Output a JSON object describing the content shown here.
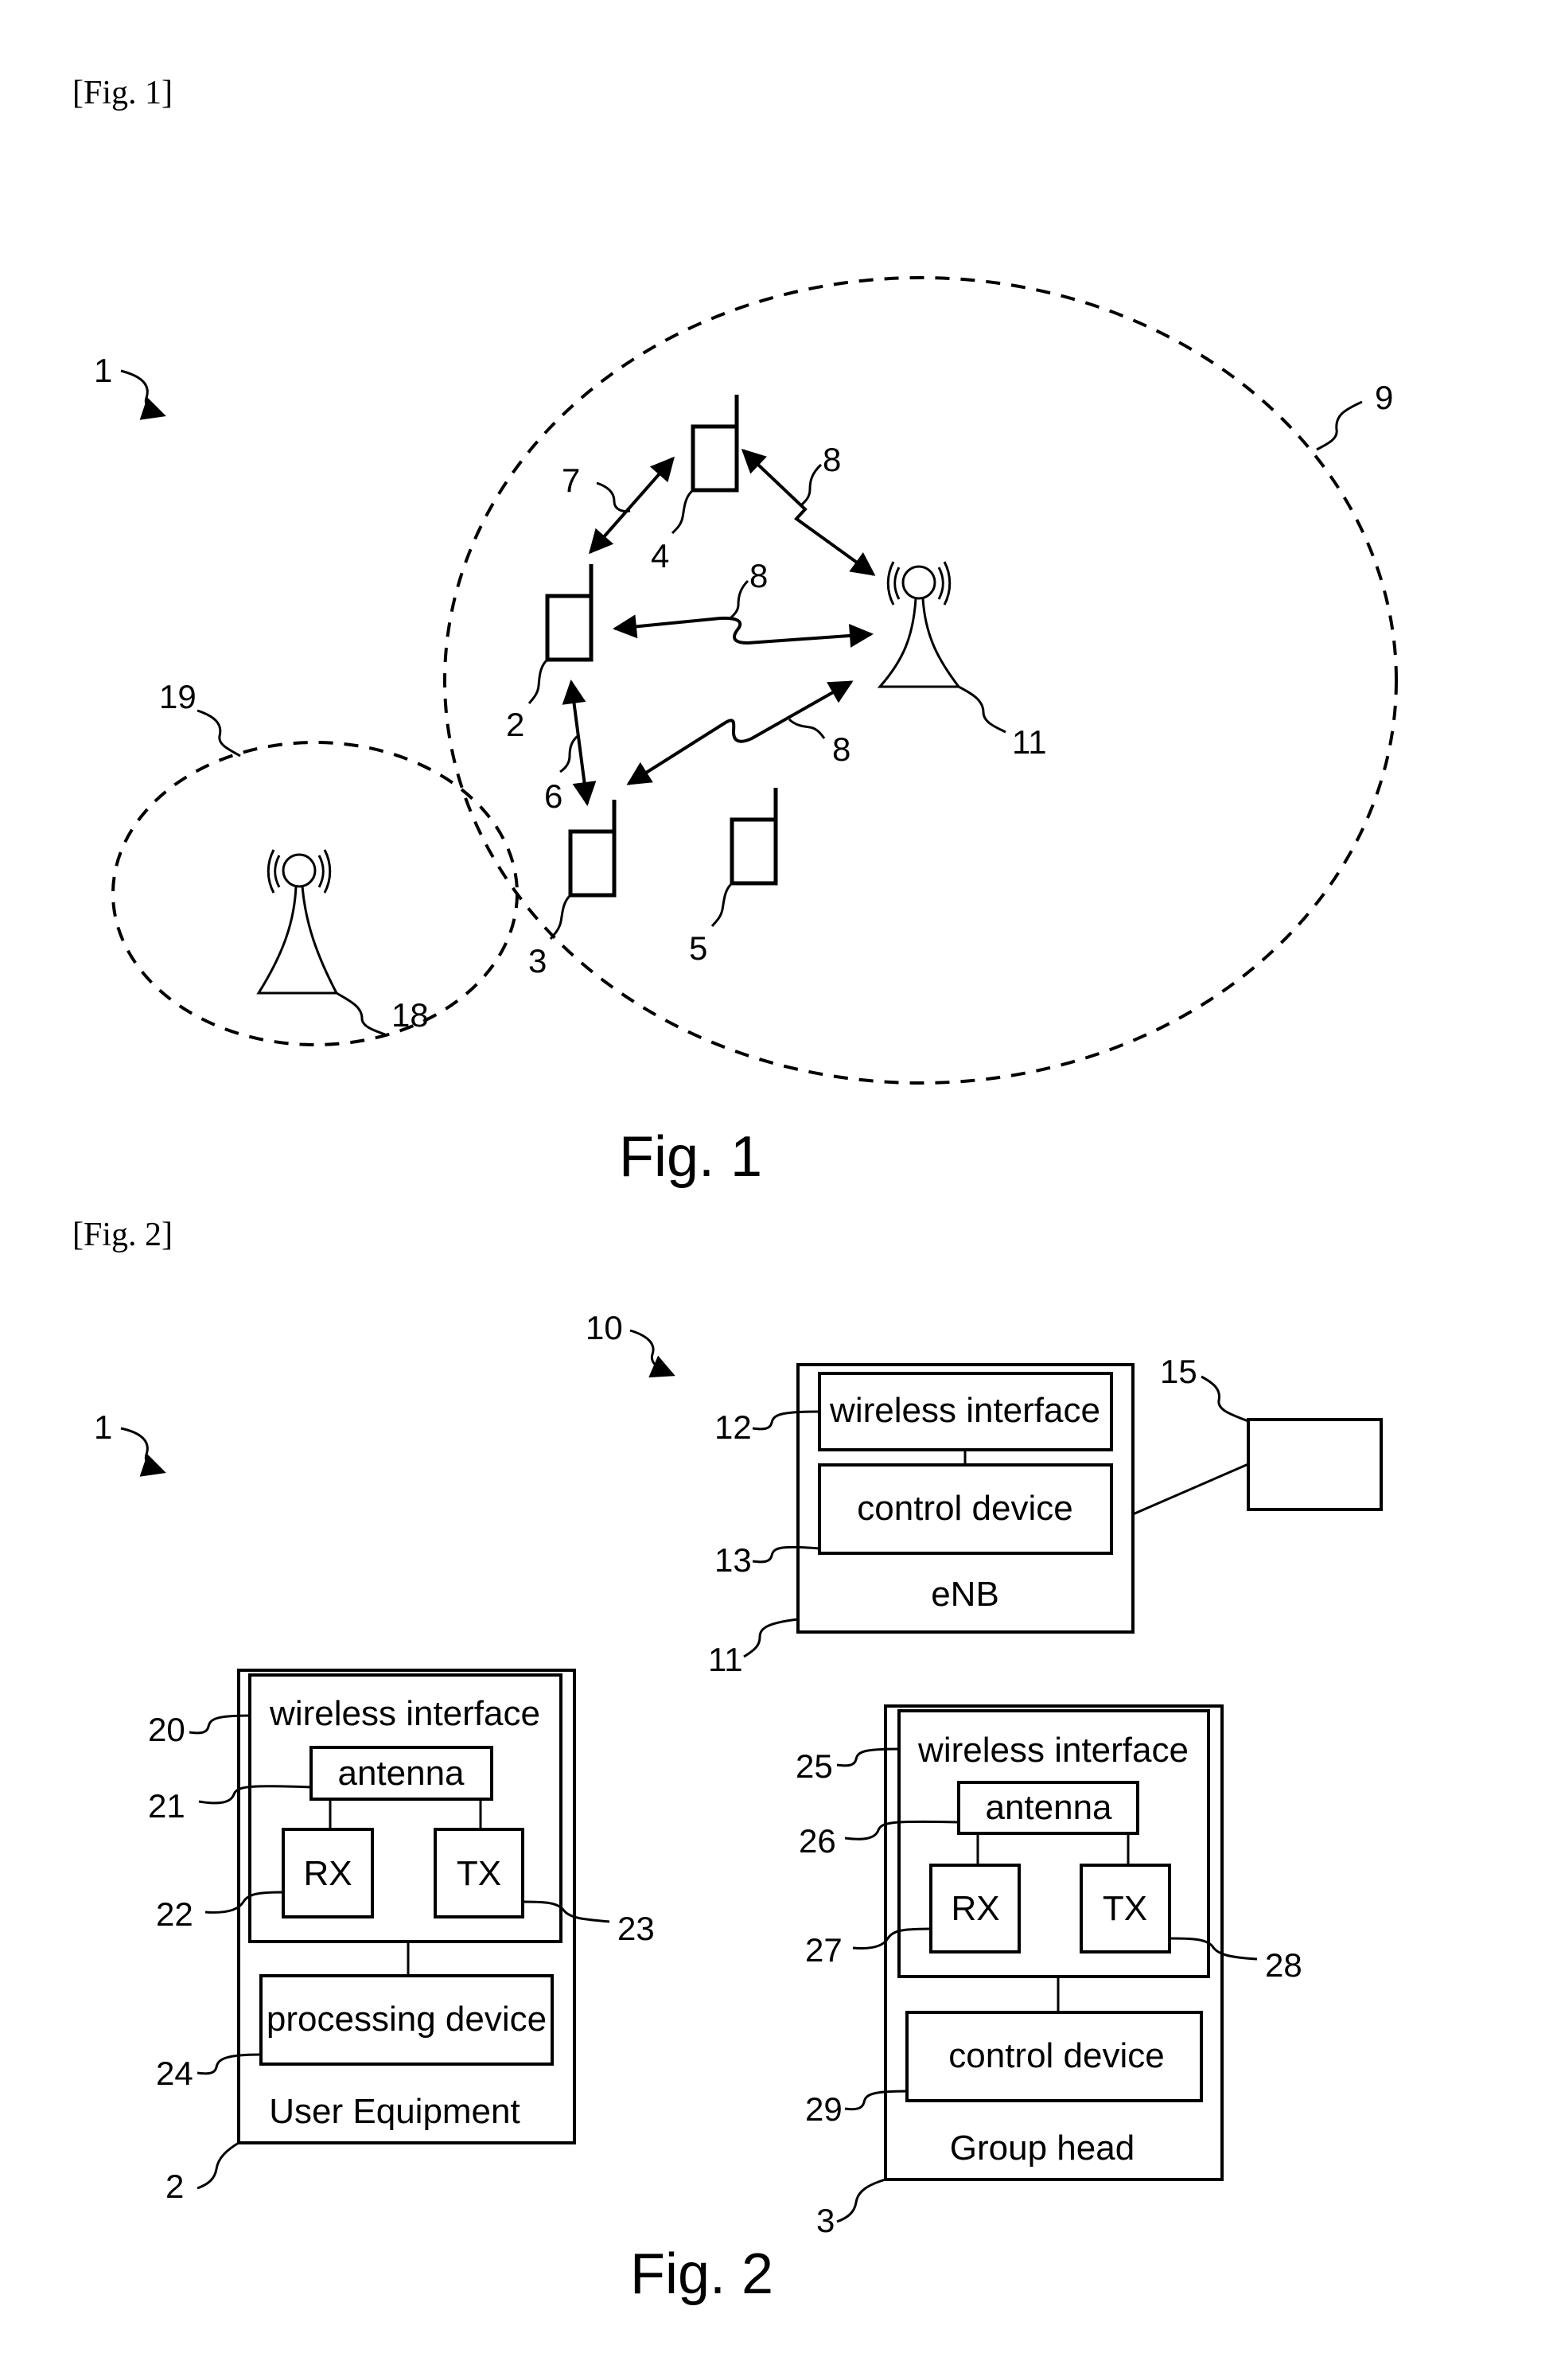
{
  "figure1": {
    "tag": "[Fig. 1]",
    "caption": "Fig. 1",
    "refs": {
      "system": "1",
      "cell_large": "9",
      "cell_small": "19",
      "ue_2": "2",
      "ue_3": "3",
      "ue_4": "4",
      "ue_5": "5",
      "link_6": "6",
      "link_7": "7",
      "link_8_top": "8",
      "link_8_mid": "8",
      "link_8_bottom": "8",
      "base_station_11": "11",
      "base_station_18": "18"
    }
  },
  "figure2": {
    "tag": "[Fig. 2]",
    "caption": "Fig. 2",
    "refs": {
      "system": "1",
      "network": "10",
      "enb": "11",
      "enb_wireless": "12",
      "enb_control": "13",
      "external_node": "15",
      "ue": "2",
      "ue_wireless": "20",
      "ue_antenna": "21",
      "ue_rx": "22",
      "ue_tx": "23",
      "ue_processing": "24",
      "gh": "3",
      "gh_wireless": "25",
      "gh_antenna": "26",
      "gh_rx": "27",
      "gh_tx": "28",
      "gh_control": "29"
    },
    "enb": {
      "wireless_interface": "wireless interface",
      "control_device": "control device",
      "title": "eNB"
    },
    "user_equipment": {
      "wireless_interface": "wireless interface",
      "antenna": "antenna",
      "rx": "RX",
      "tx": "TX",
      "processing_device": "processing device",
      "title": "User Equipment"
    },
    "group_head": {
      "wireless_interface": "wireless interface",
      "antenna": "antenna",
      "rx": "RX",
      "tx": "TX",
      "control_device": "control device",
      "title": "Group head"
    }
  }
}
